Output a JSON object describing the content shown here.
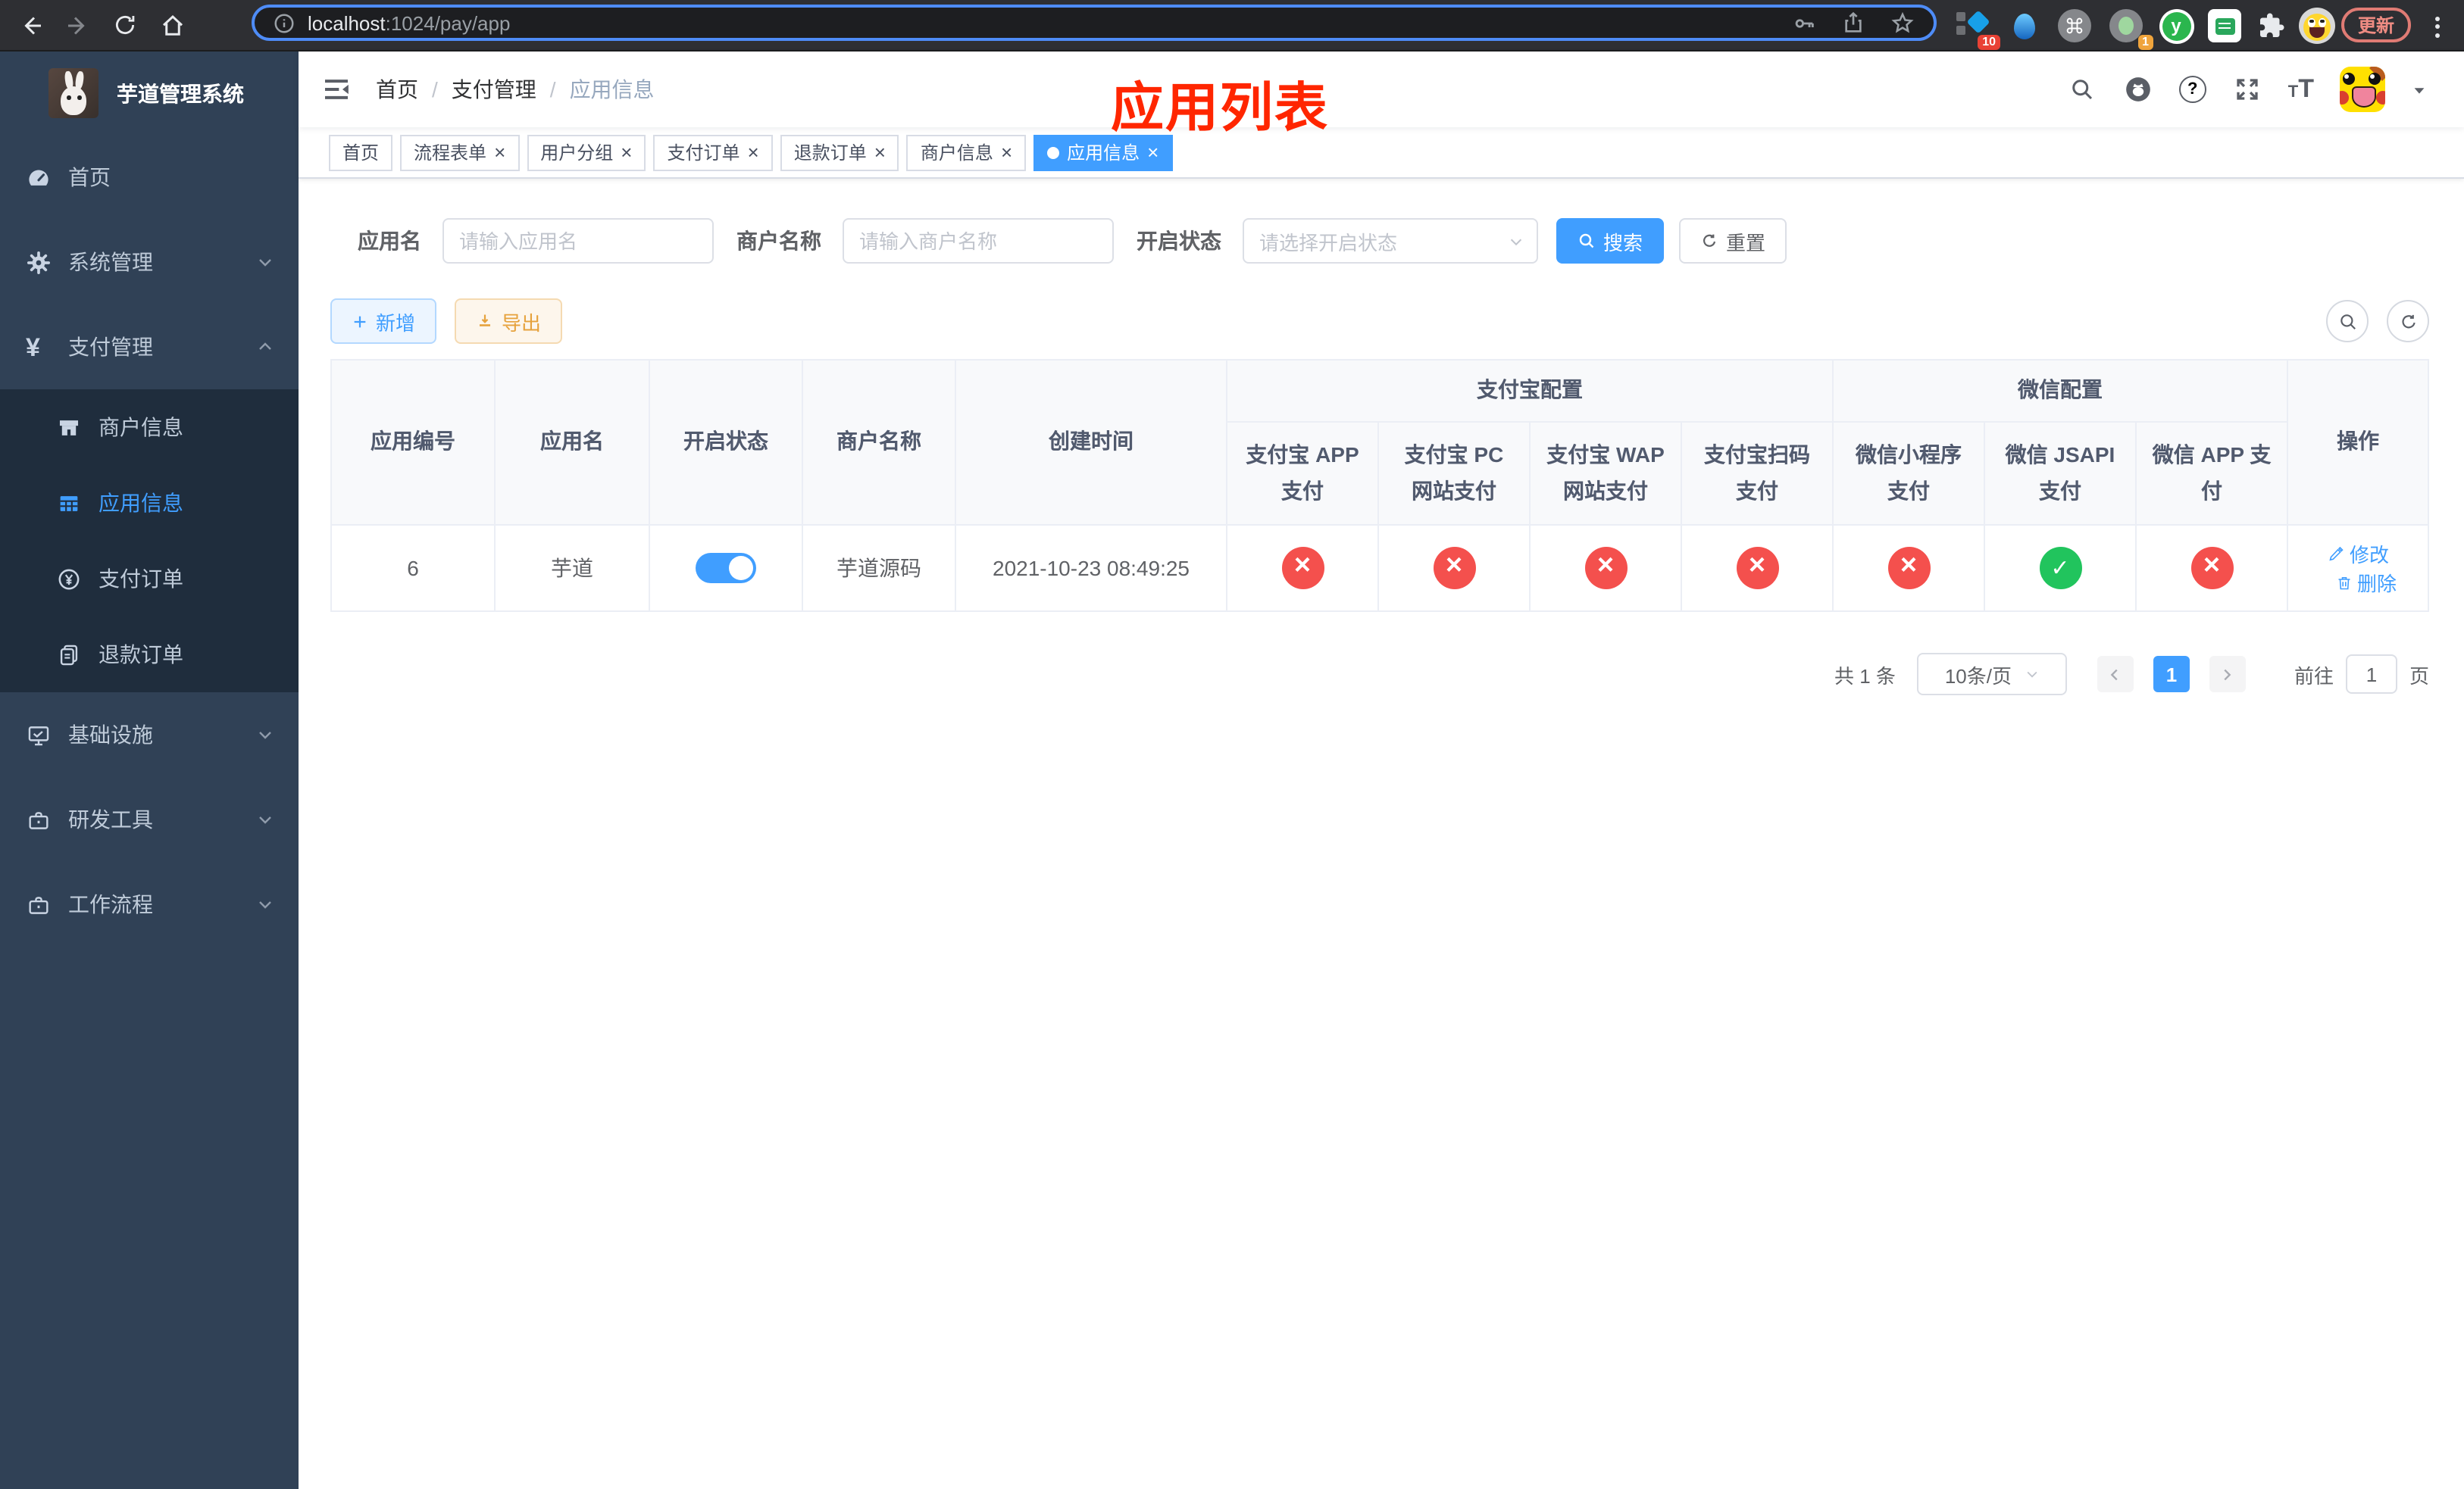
{
  "browser": {
    "url_host": "localhost",
    "url_rest": ":1024/pay/app",
    "ext_badge_blue": "10",
    "ext_badge_gray": "1",
    "update_label": "更新"
  },
  "sidebar": {
    "logo_title": "芋道管理系统",
    "active_color": "#409EFF",
    "items": [
      {
        "label": "首页"
      },
      {
        "label": "系统管理"
      },
      {
        "label": "支付管理"
      },
      {
        "label": "商户信息"
      },
      {
        "label": "应用信息"
      },
      {
        "label": "支付订单"
      },
      {
        "label": "退款订单"
      },
      {
        "label": "基础设施"
      },
      {
        "label": "研发工具"
      },
      {
        "label": "工作流程"
      }
    ]
  },
  "header": {
    "breadcrumb": [
      "首页",
      "支付管理",
      "应用信息"
    ],
    "annotation": "应用列表",
    "annotation_color": "#ff2600"
  },
  "tabs": [
    {
      "label": "首页",
      "closable": false,
      "active": false
    },
    {
      "label": "流程表单",
      "closable": true,
      "active": false
    },
    {
      "label": "用户分组",
      "closable": true,
      "active": false
    },
    {
      "label": "支付订单",
      "closable": true,
      "active": false
    },
    {
      "label": "退款订单",
      "closable": true,
      "active": false
    },
    {
      "label": "商户信息",
      "closable": true,
      "active": false
    },
    {
      "label": "应用信息",
      "closable": true,
      "active": true
    }
  ],
  "filters": {
    "app_name_label": "应用名",
    "app_name_placeholder": "请输入应用名",
    "merchant_label": "商户名称",
    "merchant_placeholder": "请输入商户名称",
    "status_label": "开启状态",
    "status_placeholder": "请选择开启状态",
    "search_label": "搜索",
    "reset_label": "重置"
  },
  "toolbar": {
    "add_label": "新增",
    "export_label": "导出"
  },
  "table": {
    "headers": {
      "app_id": "应用编号",
      "app_name": "应用名",
      "status": "开启状态",
      "merchant": "商户名称",
      "created": "创建时间",
      "group_alipay": "支付宝配置",
      "group_wechat": "微信配置",
      "alipay_app": "支付宝 APP 支付",
      "alipay_pc": "支付宝 PC 网站支付",
      "alipay_wap": "支付宝 WAP 网站支付",
      "alipay_qr": "支付宝扫码支付",
      "wx_mini": "微信小程序支付",
      "wx_jsapi": "微信 JSAPI 支付",
      "wx_app": "微信 APP 支付",
      "actions": "操作"
    },
    "status_true_color": "#21c45d",
    "status_false_color": "#f4504d",
    "row": {
      "app_id": "6",
      "app_name": "芋道",
      "status_on": true,
      "merchant": "芋道源码",
      "created": "2021-10-23 08:49:25",
      "configs": [
        false,
        false,
        false,
        false,
        false,
        true,
        false
      ],
      "edit_label": "修改",
      "delete_label": "删除"
    }
  },
  "pagination": {
    "total": "共 1 条",
    "page_size": "10条/页",
    "current_page": "1",
    "goto_label": "前往",
    "goto_value": "1",
    "page_unit": "页"
  }
}
